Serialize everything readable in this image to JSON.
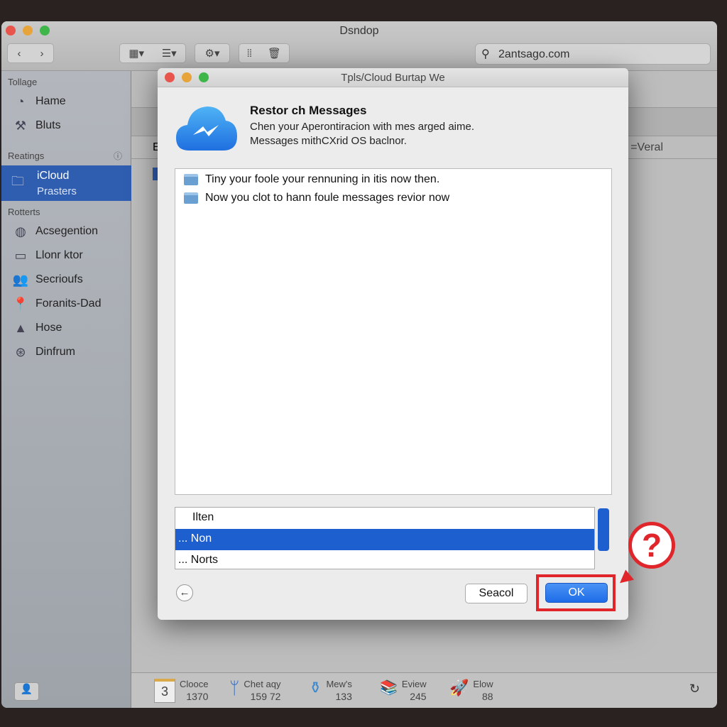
{
  "window": {
    "title": "Dsndop",
    "search_value": "2antsago.com"
  },
  "sidebar": {
    "sections": [
      "Tollage",
      "Reatings",
      "Rotterts"
    ],
    "items": [
      {
        "label": "Hame",
        "icon": "clock-icon"
      },
      {
        "label": "Bluts",
        "icon": "tools-icon"
      },
      {
        "label": "iCloud",
        "sublabel": "Prasters",
        "icon": "folder-icon",
        "selected": true
      },
      {
        "label": "Acsegention",
        "icon": "globe-icon"
      },
      {
        "label": "Llonr ktor",
        "icon": "drive-icon"
      },
      {
        "label": "Secrioufs",
        "icon": "people-icon"
      },
      {
        "label": "Foranits-Dad",
        "icon": "pin-icon"
      },
      {
        "label": "Hose",
        "icon": "warning-icon"
      },
      {
        "label": "Dinfrum",
        "icon": "gear-icon"
      }
    ]
  },
  "main": {
    "column_label": "=Veral",
    "row_letter": "E"
  },
  "dialog": {
    "title": "Tpls/Cloud Burtap We",
    "heading": "Restor ch Messages",
    "desc1": "Chen your Aperontiracion with mes arged aime.",
    "desc2": "Messages mithCXrid OS baclnor.",
    "list": [
      "Tiny your foole your rennuning in itis now then.",
      "Now you clot to hann foule messages revior now"
    ],
    "picker": [
      "Ilten",
      "... Non",
      "... Norts"
    ],
    "picker_selected": 1,
    "cancel": "Seacol",
    "ok": "OK",
    "help": "?"
  },
  "bottom": [
    {
      "label": "Clooce",
      "value": "1370",
      "badge": "3"
    },
    {
      "label": "Chet aqy",
      "value": "159 72"
    },
    {
      "label": "Mew's",
      "value": "133"
    },
    {
      "label": "Eview",
      "value": "245"
    },
    {
      "label": "Elow",
      "value": "88"
    }
  ],
  "colors": {
    "accent": "#1e5fd0",
    "highlight": "#e0252b",
    "sidebar_selected": "#2f5db0"
  }
}
